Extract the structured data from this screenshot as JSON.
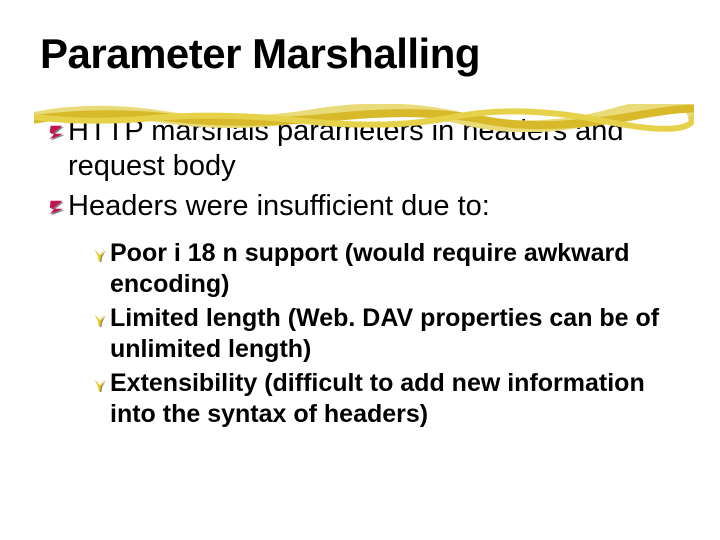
{
  "title": "Parameter Marshalling",
  "bullets": [
    {
      "text": "HTTP marshals parameters in headers and request body"
    },
    {
      "text": "Headers were insufficient due to:"
    }
  ],
  "sub_bullets": [
    {
      "text": "Poor i 18 n support (would require awkward encoding)"
    },
    {
      "text": "Limited length (Web. DAV properties can be of unlimited length)"
    },
    {
      "text": "Extensibility (difficult to add new information into the syntax of headers)"
    }
  ],
  "colors": {
    "main_bullet_fill": "#c4134e",
    "main_bullet_shadow": "#808080",
    "sub_bullet_fill": "#f2c800",
    "sub_bullet_shadow": "#808080",
    "underline_a": "#e6d24a",
    "underline_b": "#d7b92a",
    "underline_c": "#eadb7a"
  }
}
